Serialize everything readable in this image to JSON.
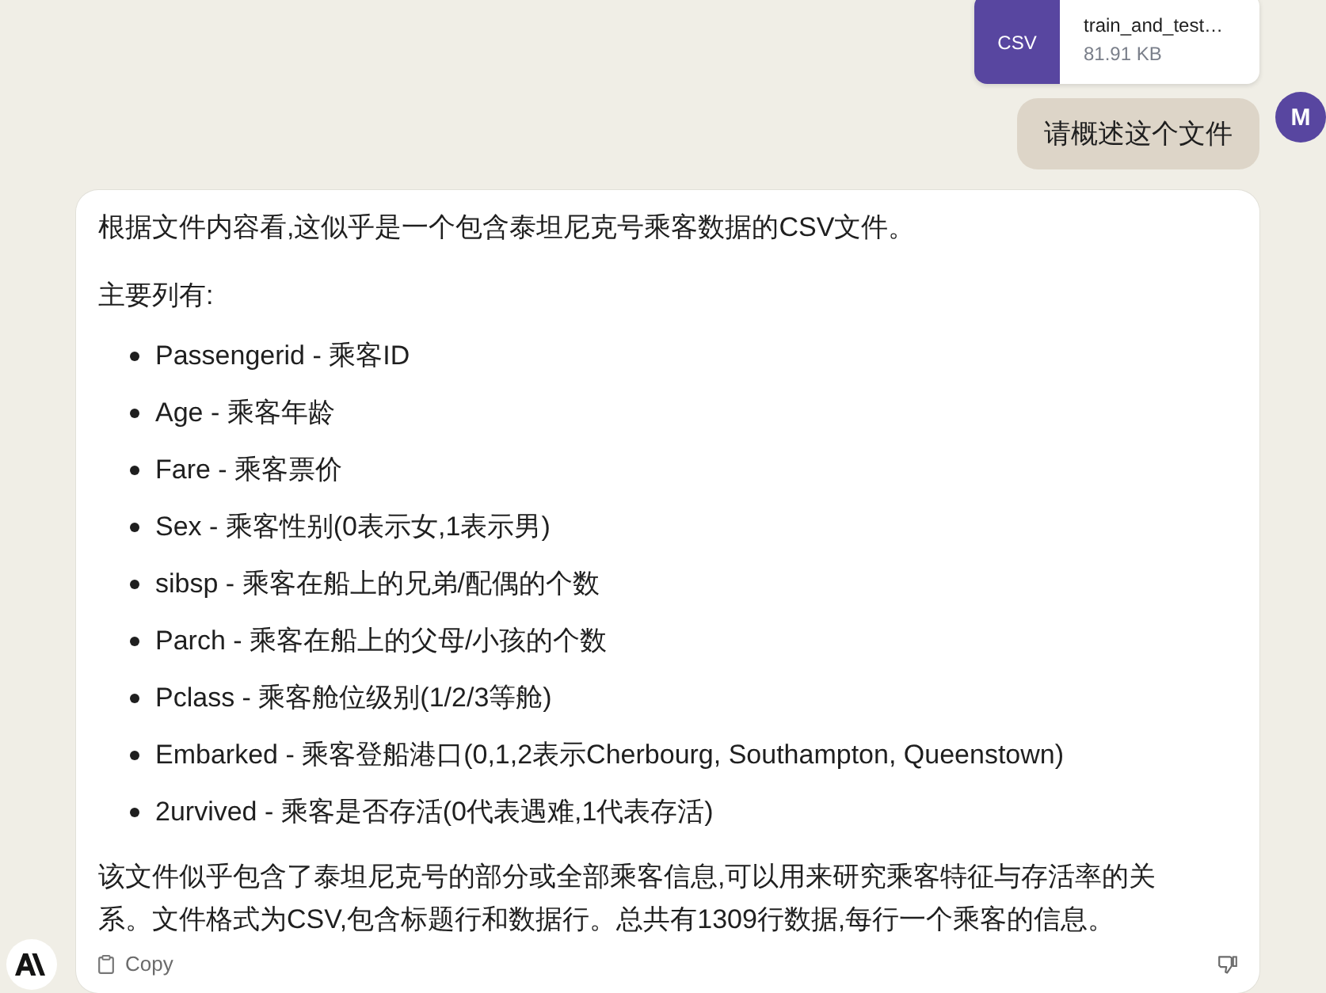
{
  "attachment": {
    "type_label": "CSV",
    "file_name": "train_and_test…",
    "file_size": "81.91 KB"
  },
  "user_message": {
    "avatar_initial": "M",
    "text": "请概述这个文件"
  },
  "response": {
    "intro": "根据文件内容看,这似乎是一个包含泰坦尼克号乘客数据的CSV文件。",
    "list_heading": "主要列有:",
    "items": [
      "Passengerid - 乘客ID",
      "Age - 乘客年龄",
      "Fare - 乘客票价",
      "Sex - 乘客性别(0表示女,1表示男)",
      "sibsp - 乘客在船上的兄弟/配偶的个数",
      "Parch - 乘客在船上的父母/小孩的个数",
      "Pclass - 乘客舱位级别(1/2/3等舱)",
      "Embarked - 乘客登船港口(0,1,2表示Cherbourg, Southampton, Queenstown)",
      "2urvived - 乘客是否存活(0代表遇难,1代表存活)"
    ],
    "summary": "该文件似乎包含了泰坦尼克号的部分或全部乘客信息,可以用来研究乘客特征与存活率的关系。文件格式为CSV,包含标题行和数据行。总共有1309行数据,每行一个乘客的信息。",
    "copy_label": "Copy"
  }
}
